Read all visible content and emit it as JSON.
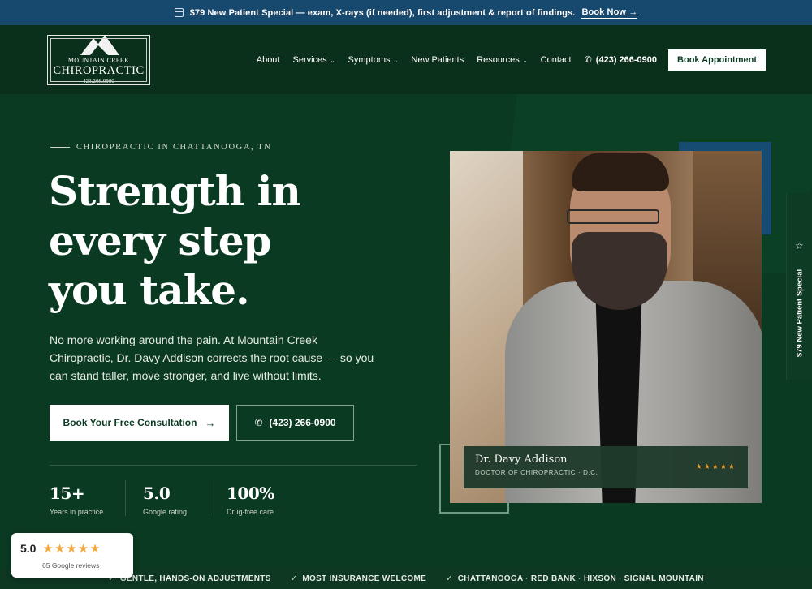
{
  "announcement": {
    "text": "$79 New Patient Special — exam, X-rays (if needed), first adjustment & report of findings.",
    "link": "Book Now →"
  },
  "logo": {
    "line1": "MOUNTAIN CREEK",
    "line2": "CHIROPRACTIC",
    "line3": "423.266.0900"
  },
  "nav": {
    "items": [
      {
        "label": "About",
        "dropdown": false
      },
      {
        "label": "Services",
        "dropdown": true
      },
      {
        "label": "Symptoms",
        "dropdown": true
      },
      {
        "label": "New Patients",
        "dropdown": false
      },
      {
        "label": "Resources",
        "dropdown": true
      },
      {
        "label": "Contact",
        "dropdown": false
      }
    ],
    "phone": "(423) 266-0900",
    "cta": "Book Appointment"
  },
  "hero": {
    "eyebrow": "CHIROPRACTIC IN CHATTANOOGA, TN",
    "title_line1": "Strength in",
    "title_line2": "every step",
    "title_line3": "you take.",
    "body": "No more working around the pain. At Mountain Creek Chiropractic, Dr. Davy Addison corrects the root cause — so you can stand taller, move stronger, and live without limits.",
    "primary_cta": "Book Your Free Consultation",
    "primary_cta_arrow": "→",
    "phone_cta": "(423) 266-0900"
  },
  "stats": [
    {
      "value": "15+",
      "label": "Years in practice"
    },
    {
      "value": "5.0",
      "label": "Google rating"
    },
    {
      "value": "100%",
      "label": "Drug-free care"
    }
  ],
  "doctor": {
    "name": "Dr. Davy Addison",
    "title": "DOCTOR OF CHIROPRACTIC · D.C.",
    "stars": "★★★★★"
  },
  "side_tab": {
    "label": "$79 New Patient Special"
  },
  "ribbon": {
    "items": [
      "GENTLE, HANDS-ON ADJUSTMENTS",
      "MOST INSURANCE WELCOME",
      "CHATTANOOGA · RED BANK · HIXSON · SIGNAL MOUNTAIN"
    ]
  },
  "google_card": {
    "score": "5.0",
    "stars": "★★★★★",
    "reviews": "65 Google reviews"
  },
  "colors": {
    "background": "#0b3a22",
    "announcement_bar": "#17486e",
    "accent_blue": "#164c72",
    "star_gold": "#f2a93b"
  }
}
